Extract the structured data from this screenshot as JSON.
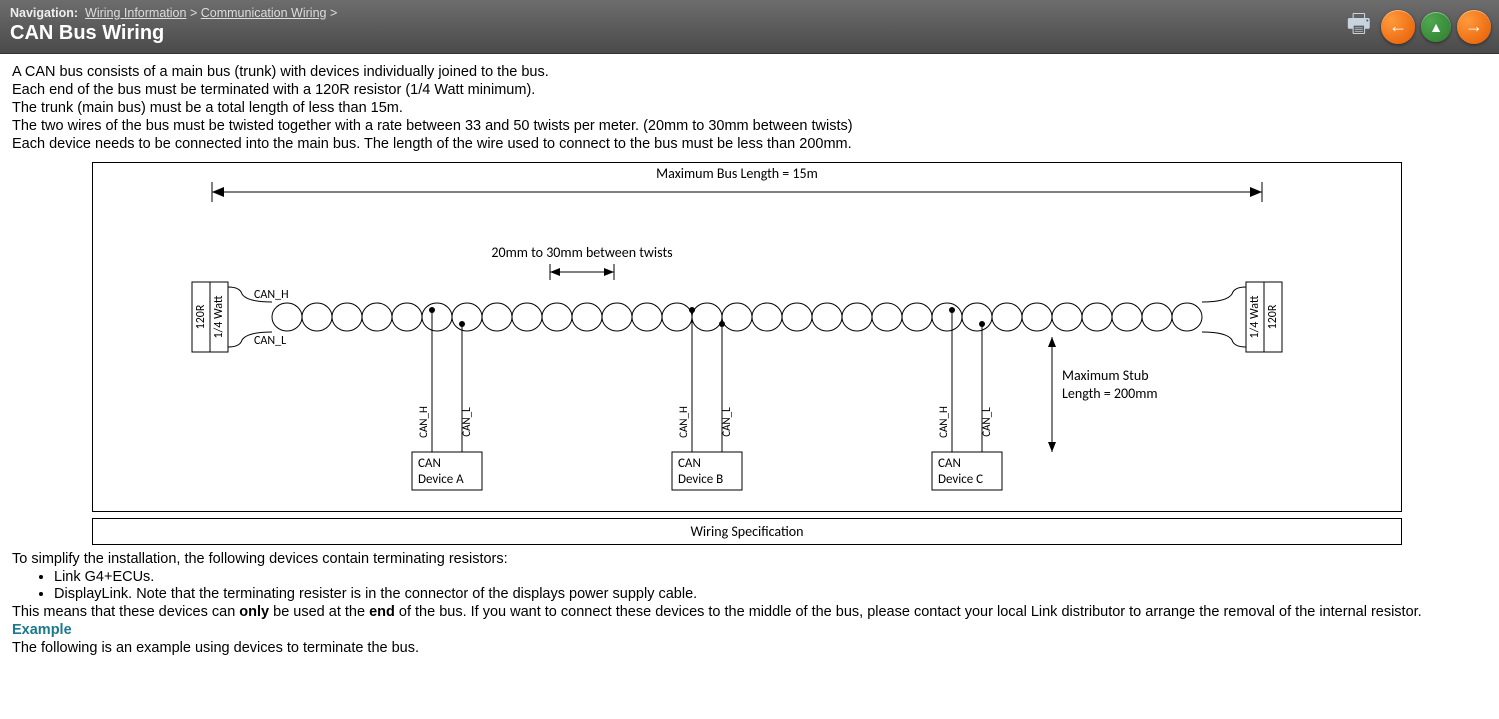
{
  "breadcrumb": {
    "label": "Navigation:",
    "items": [
      "Wiring Information",
      "Communication Wiring"
    ],
    "sep": ">"
  },
  "title": "CAN Bus Wiring",
  "intro": [
    "A CAN bus consists of a main bus (trunk) with devices individually joined to the bus.",
    "Each end of the bus must be terminated with a 120R resistor (1/4 Watt minimum).",
    "The trunk (main bus) must be a total length of less than 15m.",
    "The two wires of the bus must be twisted together with a rate between 33 and 50 twists per meter. (20mm to 30mm between twists)",
    "Each device needs to be connected into the main bus. The length of the wire used to connect to the bus must be less than 200mm."
  ],
  "diagram": {
    "max_bus_length": "Maximum Bus Length = 15m",
    "twist_label": "20mm to 30mm between twists",
    "stub_label": "Maximum Stub Length = 200mm",
    "can_h": "CAN_H",
    "can_l": "CAN_L",
    "r_value": "120R",
    "r_watt": "1/4 Watt",
    "dev_label": "CAN",
    "dev_a": "Device A",
    "dev_b": "Device B",
    "dev_c": "Device C",
    "caption": "Wiring Specification"
  },
  "post": {
    "simplify": "To simplify the installation, the following devices contain terminating resistors:",
    "bullets": [
      "Link G4+ECUs.",
      "DisplayLink.  Note that the terminating resister is in the connector of the displays power supply cable."
    ],
    "means_pre": "This means that these devices can ",
    "means_bold1": "only",
    "means_mid": " be used at the ",
    "means_bold2": "end",
    "means_post": " of the bus. If you want to connect these devices to the middle of the bus, please contact your local Link distributor to arrange the removal of the internal resistor.",
    "example_head": "Example",
    "example_line": "The following is an example using devices to terminate the bus."
  }
}
